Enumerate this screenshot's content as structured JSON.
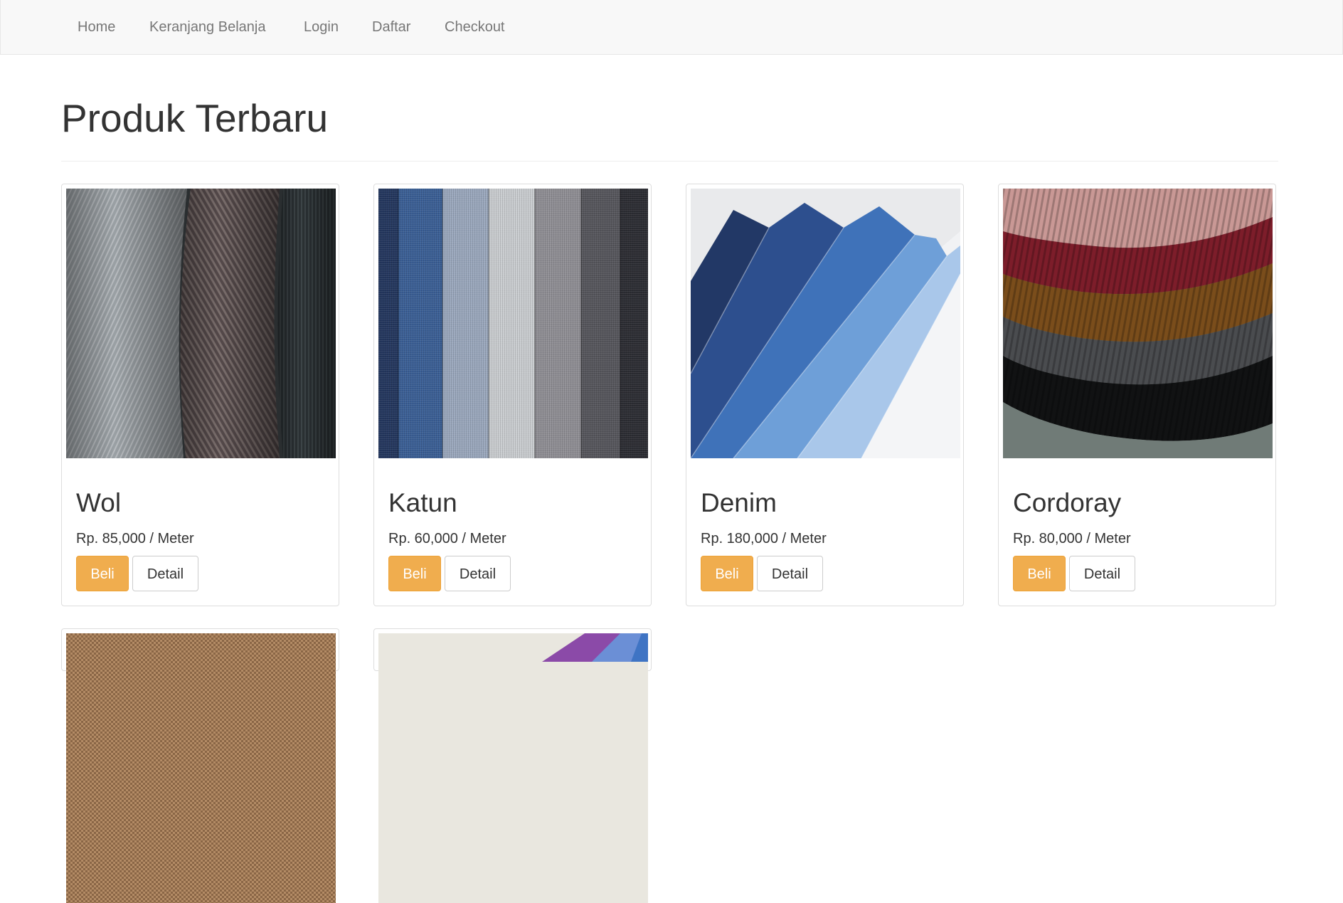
{
  "nav": {
    "items": [
      {
        "label": "Home"
      },
      {
        "label": "Keranjang Belanja"
      },
      {
        "label": "Login"
      },
      {
        "label": "Daftar"
      },
      {
        "label": "Checkout"
      }
    ]
  },
  "main": {
    "title": "Produk Terbaru",
    "products": [
      {
        "name": "Wol",
        "price": "Rp. 85,000 / Meter",
        "buy_label": "Beli",
        "detail_label": "Detail",
        "image": "wool-fabric-rolls-image"
      },
      {
        "name": "Katun",
        "price": "Rp. 60,000 / Meter",
        "buy_label": "Beli",
        "detail_label": "Detail",
        "image": "cotton-fabric-swatches-image"
      },
      {
        "name": "Denim",
        "price": "Rp. 180,000 / Meter",
        "buy_label": "Beli",
        "detail_label": "Detail",
        "image": "denim-fabric-fan-image"
      },
      {
        "name": "Cordoray",
        "price": "Rp. 80,000 / Meter",
        "buy_label": "Beli",
        "detail_label": "Detail",
        "image": "corduroy-fabric-stack-image"
      }
    ],
    "partial_products": [
      {
        "image": "tan-fabric-image"
      },
      {
        "image": "colorful-fabric-image"
      }
    ]
  },
  "colors": {
    "accent_button": "#f0ad4e",
    "navbar_bg": "#f8f8f8",
    "nav_text": "#777777"
  }
}
